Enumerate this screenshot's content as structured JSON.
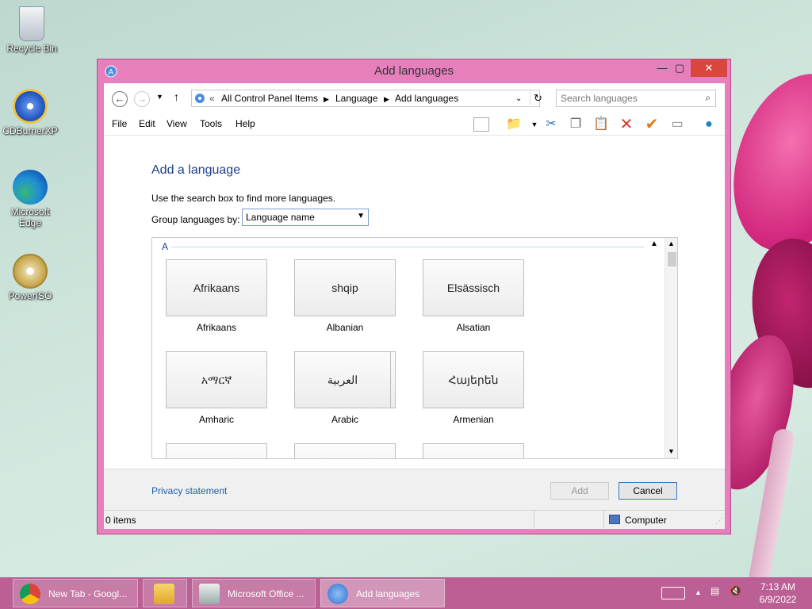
{
  "desktop": {
    "icons": [
      {
        "label": "Recycle Bin"
      },
      {
        "label": "CDBurnerXP"
      },
      {
        "label": "Microsoft Edge"
      },
      {
        "label": "PowerISO"
      }
    ]
  },
  "window": {
    "title": "Add languages",
    "controls": {
      "minimize": "—",
      "maximize": "▢",
      "close": "✕"
    },
    "address": {
      "prefix": "«",
      "crumbs": [
        "All Control Panel Items",
        "Language",
        "Add languages"
      ]
    },
    "search": {
      "placeholder": "Search languages"
    },
    "menu": [
      "File",
      "Edit",
      "View",
      "Tools",
      "Help"
    ],
    "heading": "Add a language",
    "hint": "Use the search box to find more languages.",
    "group_by": {
      "label": "Group languages by:",
      "selected": "Language name"
    },
    "list": {
      "group": "A",
      "languages": [
        {
          "native": "Afrikaans",
          "name": "Afrikaans"
        },
        {
          "native": "shqip",
          "name": "Albanian"
        },
        {
          "native": "Elsässisch",
          "name": "Alsatian"
        },
        {
          "native": "አማርኛ",
          "name": "Amharic"
        },
        {
          "native": "العربية",
          "name": "Arabic"
        },
        {
          "native": "Հայերեն",
          "name": "Armenian"
        }
      ]
    },
    "footer": {
      "privacy": "Privacy statement",
      "add": "Add",
      "cancel": "Cancel"
    },
    "status": {
      "items": "0 items",
      "location": "Computer"
    }
  },
  "taskbar": {
    "tasks": [
      {
        "label": "New Tab - Googl..."
      },
      {
        "label": ""
      },
      {
        "label": "Microsoft Office ..."
      },
      {
        "label": "Add languages"
      }
    ],
    "clock": {
      "time": "7:13 AM",
      "date": "6/9/2022"
    }
  }
}
